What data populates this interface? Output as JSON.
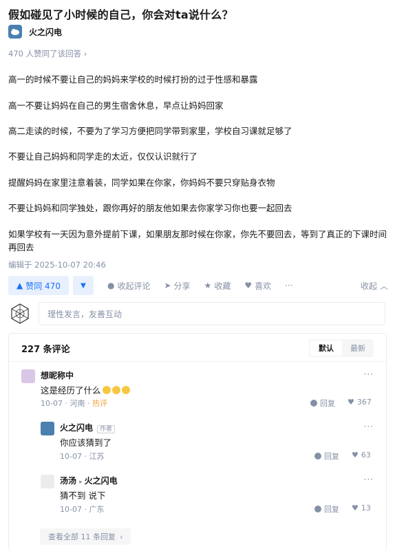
{
  "question": {
    "title": "假如碰见了小时候的自己，你会对ta说什么？"
  },
  "answer": {
    "author": "火之闪电",
    "upvote_summary": "470 人赞同了该回答 ›",
    "paragraphs": [
      "高一的时候不要让自己的妈妈来学校的时候打扮的过于性感和暴露",
      "高一不要让妈妈在自己的男生宿舍休息，早点让妈妈回家",
      "高二走读的时候，不要为了学习方便把同学带到家里，学校自习课就足够了",
      "不要让自己妈妈和同学走的太近，仅仅认识就行了",
      "提醒妈妈在家里注意着装，同学如果在你家，你妈妈不要只穿贴身衣物",
      "不要让妈妈和同学独处，跟你再好的朋友他如果去你家学习你也要一起回去",
      "如果学校有一天因为意外提前下课，如果朋友那时候在你家，你先不要回去，等到了真正的下课时间再回去"
    ],
    "edited": "编辑于 2025-10-07 20:46"
  },
  "actions": {
    "vote_up": "赞同 470",
    "collapse_comments": "收起评论",
    "share": "分享",
    "favorite": "收藏",
    "like": "喜欢",
    "more": "···",
    "collapse": "收起"
  },
  "comment_box": {
    "placeholder": "理性发言，友善互动"
  },
  "comments": {
    "count_label": "227 条评论",
    "sort_default": "默认",
    "sort_latest": "最新",
    "items": [
      {
        "user": "想昵称中",
        "text": "这是经历了什么",
        "date": "10-07",
        "location": "河南",
        "tag": "热评",
        "reply": "回复",
        "likes": "367",
        "more": "···"
      },
      {
        "user": "火之闪电",
        "author_tag": "作者",
        "text": "你应该猜到了",
        "date": "10-07",
        "location": "江苏",
        "reply": "回复",
        "likes": "63",
        "more": "···"
      },
      {
        "user": "汤汤",
        "reply_to": "火之闪电",
        "text": "猜不到 说下",
        "date": "10-07",
        "location": "广东",
        "reply": "回复",
        "likes": "13",
        "more": "···"
      }
    ],
    "view_all": "查看全部 11 条回复"
  },
  "colors": {
    "accent": "#1772f6",
    "muted": "#8590a6",
    "hot": "#f0a13a"
  }
}
